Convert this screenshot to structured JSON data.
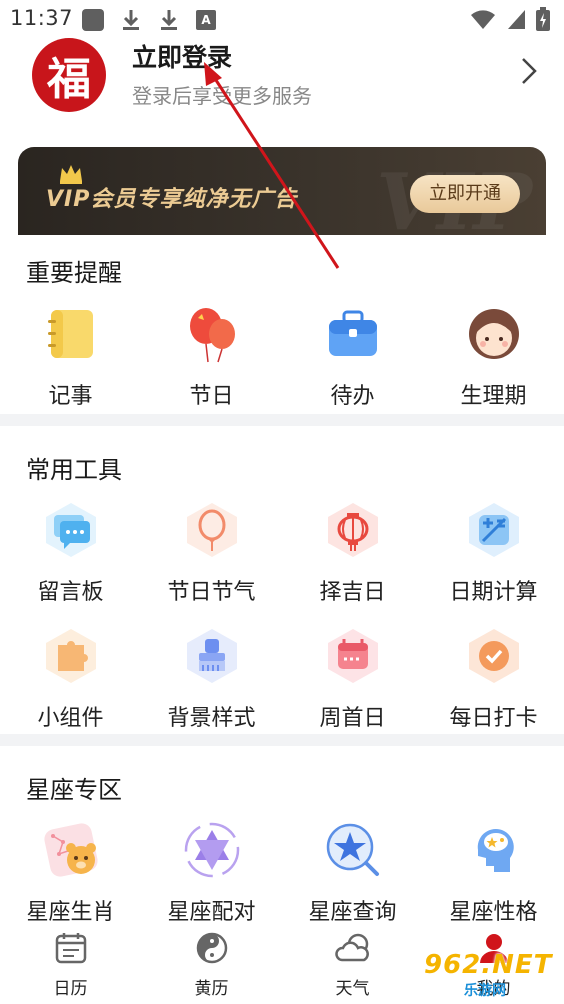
{
  "status_bar": {
    "time": "11:37",
    "a_badge": "A"
  },
  "header": {
    "avatar_char": "福",
    "login_title": "立即登录",
    "login_subtitle": "登录后享受更多服务"
  },
  "vip_banner": {
    "text": "VIP会员专享纯净无广告",
    "button": "立即开通",
    "watermark": "VIP"
  },
  "sections": [
    {
      "title": "重要提醒",
      "items": [
        {
          "label": "记事",
          "icon": "notebook-icon"
        },
        {
          "label": "节日",
          "icon": "balloon-icon"
        },
        {
          "label": "待办",
          "icon": "briefcase-icon"
        },
        {
          "label": "生理期",
          "icon": "girl-face-icon"
        }
      ]
    },
    {
      "title": "常用工具",
      "items": [
        {
          "label": "留言板",
          "icon": "message-board-icon"
        },
        {
          "label": "节日节气",
          "icon": "festival-balloon-icon"
        },
        {
          "label": "择吉日",
          "icon": "lantern-icon"
        },
        {
          "label": "日期计算",
          "icon": "calculator-icon"
        },
        {
          "label": "小组件",
          "icon": "widget-puzzle-icon"
        },
        {
          "label": "背景样式",
          "icon": "brush-icon"
        },
        {
          "label": "周首日",
          "icon": "calendar-week-icon"
        },
        {
          "label": "每日打卡",
          "icon": "checkin-icon"
        }
      ]
    },
    {
      "title": "星座专区",
      "items": [
        {
          "label": "星座生肖",
          "icon": "zodiac-bear-icon"
        },
        {
          "label": "星座配对",
          "icon": "hexagram-icon"
        },
        {
          "label": "星座查询",
          "icon": "star-search-icon"
        },
        {
          "label": "星座性格",
          "icon": "head-stars-icon"
        }
      ]
    }
  ],
  "bottom_nav": [
    {
      "label": "日历",
      "icon": "calendar-icon"
    },
    {
      "label": "黄历",
      "icon": "yin-yang-icon"
    },
    {
      "label": "天气",
      "icon": "cloud-icon"
    },
    {
      "label": "我的",
      "icon": "profile-icon"
    }
  ],
  "watermark": {
    "top": "962.NET",
    "bottom": "乐游网"
  },
  "colors": {
    "avatar_red": "#c8151b",
    "vip_gold": "#eccb93",
    "vip_bg": "#2a2520",
    "divider": "#f2f3f5",
    "annotation_arrow": "#d0151b"
  }
}
